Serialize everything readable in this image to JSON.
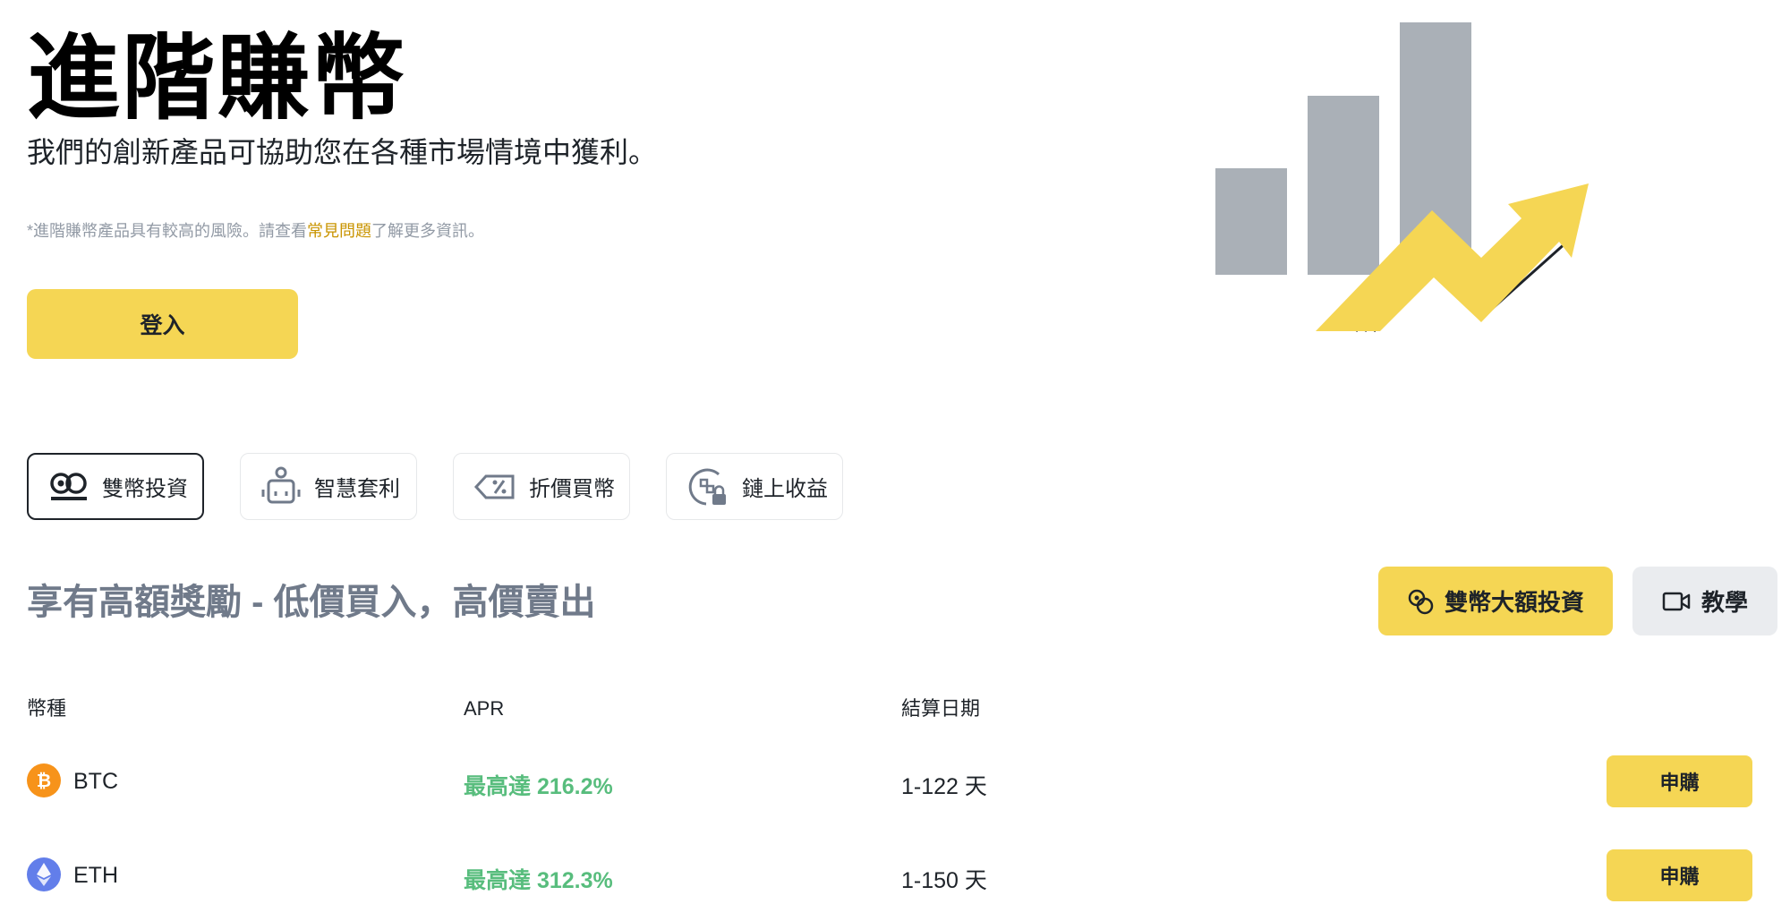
{
  "hero": {
    "title": "進階賺幣",
    "subtitle": "我們的創新產品可協助您在各種市場情境中獲利。",
    "note_prefix": "*進階賺幣產品具有較高的風險。請查看",
    "note_link": "常見問題",
    "note_suffix": "了解更多資訊。",
    "login_label": "登入"
  },
  "tabs": [
    {
      "label": "雙幣投資",
      "icon": "dual-coin-icon",
      "active": true
    },
    {
      "label": "智慧套利",
      "icon": "robot-icon",
      "active": false
    },
    {
      "label": "折價買幣",
      "icon": "discount-tag-icon",
      "active": false
    },
    {
      "label": "鏈上收益",
      "icon": "onchain-lock-icon",
      "active": false
    }
  ],
  "section": {
    "title": "享有高額獎勵 - 低價買入，高價賣出",
    "vip_button": "雙幣大額投資",
    "tutorial_button": "教學"
  },
  "table": {
    "headers": {
      "coin": "幣種",
      "apr": "APR",
      "settlement": "結算日期"
    },
    "rows": [
      {
        "coin": "BTC",
        "apr": "最高達 216.2%",
        "term": "1-122 天",
        "action": "申購",
        "icon_color": "#f7931a"
      },
      {
        "coin": "ETH",
        "apr": "最高達 312.3%",
        "term": "1-150 天",
        "action": "申購",
        "icon_color": "#627eea"
      }
    ]
  },
  "colors": {
    "accent": "#f5d654",
    "positive": "#58bd7d",
    "link": "#c99400"
  }
}
